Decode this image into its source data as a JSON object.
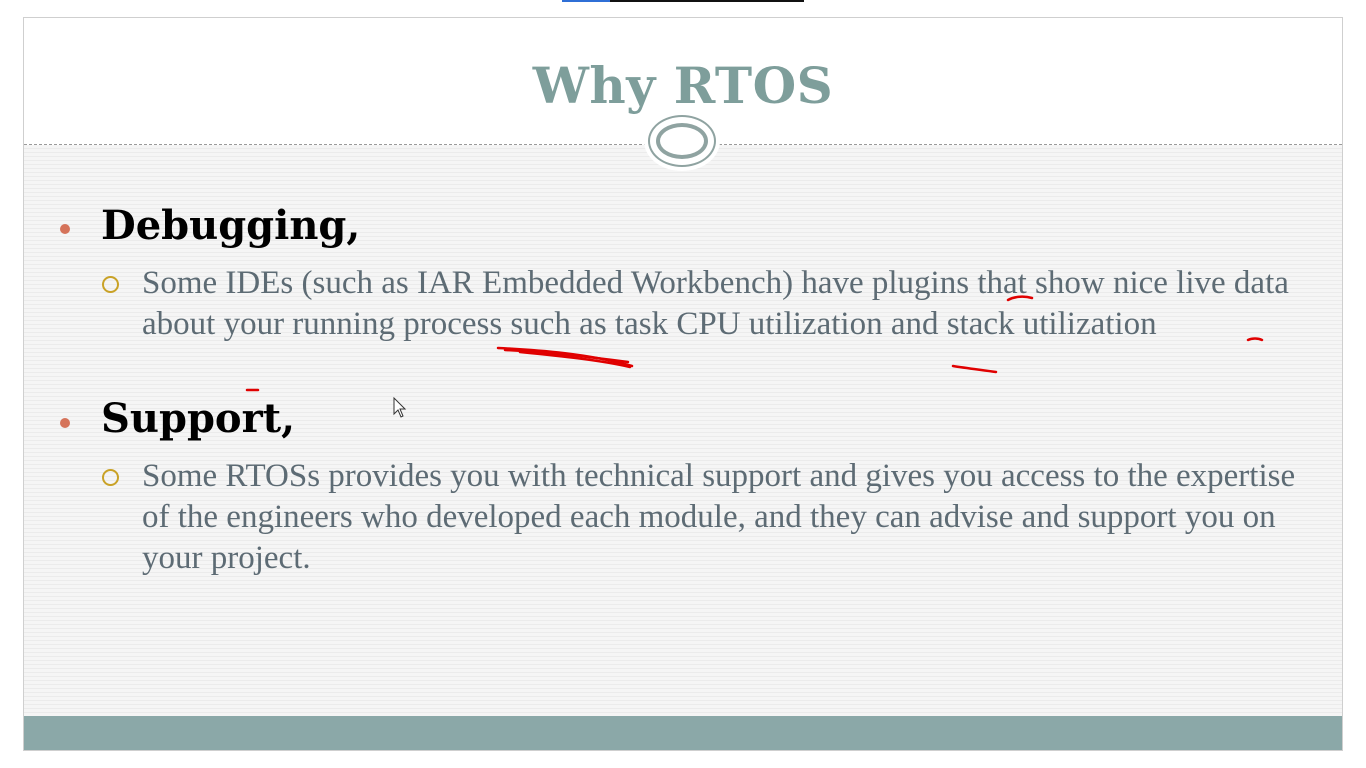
{
  "player": {
    "progress": 0.2
  },
  "slide": {
    "title": "Why RTOS",
    "sections": [
      {
        "heading": "Debugging,",
        "text": "Some IDEs (such as IAR Embedded Workbench) have plugins that show nice live data about your running process such as task CPU utilization and stack utilization"
      },
      {
        "heading": "Support,",
        "text": "Some RTOSs provides you with technical support and gives you access to the expertise of the engineers who developed each module, and they can advise and support you on your project."
      }
    ]
  },
  "colors": {
    "title": "#7e9e9b",
    "bullet": "#d5735a",
    "sub_bullet": "#c9a227",
    "body_text": "#5d6b74",
    "footer": "#8ba8a8",
    "annotation_ink": "#e00000"
  },
  "icons": {
    "divider_ornament": "double-ring-icon",
    "pointer": "mouse-cursor-icon"
  }
}
